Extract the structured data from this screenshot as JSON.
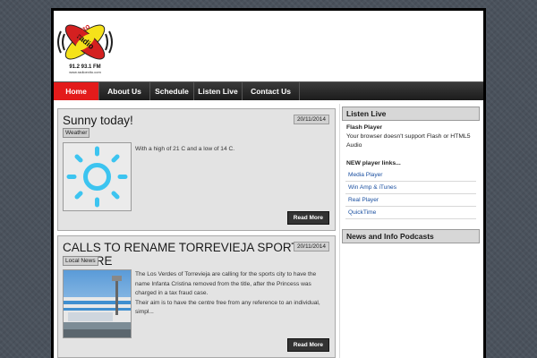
{
  "nav": {
    "items": [
      {
        "label": "Home",
        "active": true
      },
      {
        "label": "About Us",
        "active": false
      },
      {
        "label": "Schedule",
        "active": false
      },
      {
        "label": "Listen Live",
        "active": false
      },
      {
        "label": "Contact Us",
        "active": false
      }
    ]
  },
  "logo": {
    "text": "radio exito",
    "frequency": "91.2  93.1 FM",
    "url": "www.radioexito.com"
  },
  "posts": [
    {
      "title": "Sunny today!",
      "date": "20/11/2014",
      "category": "Weather",
      "excerpt": "With a high of 21 C and a low of 14 C.",
      "read_more": "Read More"
    },
    {
      "title": "CALLS TO RENAME TORREVIEJA SPORTS CENTRE",
      "date": "20/11/2014",
      "category": "Local News",
      "excerpt": "The Los Verdes of Torrevieja are calling for the sports city to have the name Infanta Cristina removed from the title, after the Princess was charged in a tax fraud case.",
      "excerpt2": "Their aim is to have the centre free from any reference to an individual, simpl...",
      "read_more": "Read More"
    }
  ],
  "sidebar": {
    "listen_live": {
      "heading": "Listen Live",
      "player_title": "Flash Player",
      "player_message": "Your browser doesn't support Flash or HTML5 Audio",
      "links_title": "NEW player links...",
      "links": [
        "Media Player",
        "Win Amp & iTunes",
        "Real Player",
        "QuickTime"
      ]
    },
    "podcasts": {
      "heading": "News and Info Podcasts"
    }
  },
  "colors": {
    "accent": "#e31b1b",
    "sun": "#3cc4f0",
    "nav_bg": "#222222"
  }
}
